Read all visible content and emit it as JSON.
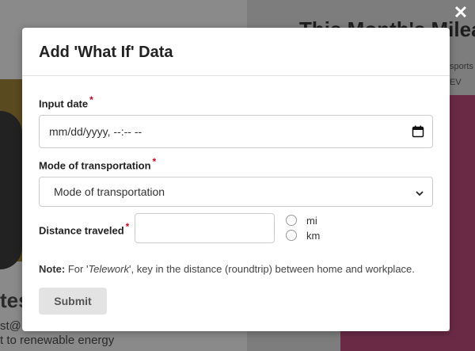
{
  "background": {
    "left_heading_fragment": "tes",
    "left_email_fragment": "st@",
    "left_line_fragment": "t to renewable energy",
    "right_title_fragment": "This Month's Milea",
    "right_sub_fragment": "sports",
    "right_legend_fragment": "EV"
  },
  "modal": {
    "title": "Add 'What If' Data",
    "close_icon": "close-icon",
    "fields": {
      "input_date": {
        "label": "Input date",
        "required_mark": "*",
        "value": "mm/dd/yyyy, --:-- --"
      },
      "mode": {
        "label": "Mode of transportation",
        "required_mark": "*",
        "selected": "Mode of transportation"
      },
      "distance": {
        "label": "Distance traveled",
        "required_mark": "*",
        "value": "",
        "unit_options": [
          "mi",
          "km"
        ]
      }
    },
    "note": {
      "prefix": "Note:",
      "text_before": " For '",
      "highlight": "Telework",
      "text_after": "', key in the distance (roundtrip) between home and workplace."
    },
    "submit_label": "Submit"
  },
  "colors": {
    "required": "#d0021b",
    "overlay": "#5c5c5c",
    "button_bg": "#e3e3e3"
  }
}
